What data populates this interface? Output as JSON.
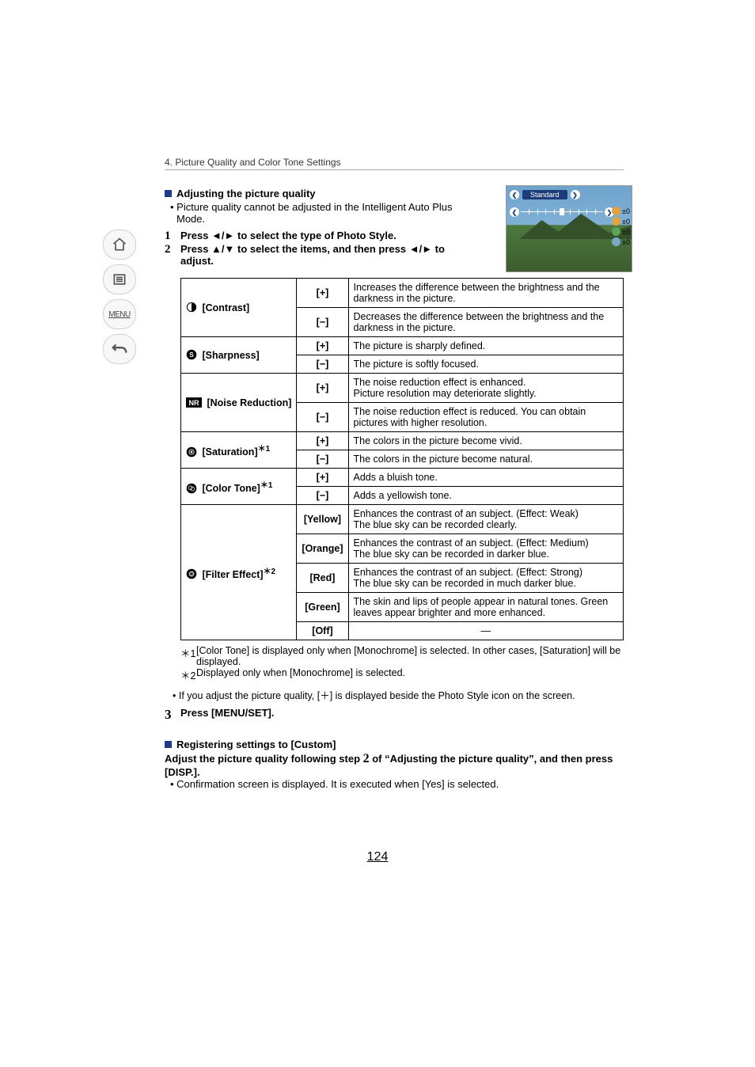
{
  "chapter": "4. Picture Quality and Color Tone Settings",
  "nav": {
    "menu_label": "MENU"
  },
  "section1": {
    "heading": "Adjusting the picture quality",
    "note": "Picture quality cannot be adjusted in the Intelligent Auto Plus Mode.",
    "step1_num": "1",
    "step1": "Press ◄/► to select the type of Photo Style.",
    "step2_num": "2",
    "step2": "Press ▲/▼ to select the items, and then press ◄/► to adjust."
  },
  "thumb": {
    "label": "Standard",
    "stats": [
      "±0",
      "±0",
      "±0",
      "±0"
    ]
  },
  "table": {
    "rows": [
      {
        "name": "[Contrast]",
        "icon": "contrast-icon",
        "items": [
          {
            "k": "[+]",
            "d": "Increases the difference between the brightness and the darkness in the picture."
          },
          {
            "k": "[−]",
            "d": "Decreases the difference between the brightness and the darkness in the picture."
          }
        ]
      },
      {
        "name": "[Sharpness]",
        "icon": "sharpness-icon",
        "items": [
          {
            "k": "[+]",
            "d": "The picture is sharply defined."
          },
          {
            "k": "[−]",
            "d": "The picture is softly focused."
          }
        ]
      },
      {
        "name": "[Noise Reduction]",
        "icon": "nr-icon",
        "items": [
          {
            "k": "[+]",
            "d": "The noise reduction effect is enhanced.\nPicture resolution may deteriorate slightly."
          },
          {
            "k": "[−]",
            "d": "The noise reduction effect is reduced. You can obtain pictures with higher resolution."
          }
        ]
      },
      {
        "name": "[Saturation]",
        "sup": "＊1",
        "icon": "saturation-icon",
        "items": [
          {
            "k": "[+]",
            "d": "The colors in the picture become vivid."
          },
          {
            "k": "[−]",
            "d": "The colors in the picture become natural."
          }
        ]
      },
      {
        "name": "[Color Tone]",
        "sup": "＊1",
        "icon": "colortone-icon",
        "items": [
          {
            "k": "[+]",
            "d": "Adds a bluish tone."
          },
          {
            "k": "[−]",
            "d": "Adds a yellowish tone."
          }
        ]
      },
      {
        "name": "[Filter Effect]",
        "sup": "＊2",
        "icon": "filter-icon",
        "items": [
          {
            "k": "[Yellow]",
            "d": "Enhances the contrast of an subject. (Effect: Weak)\nThe blue sky can be recorded clearly."
          },
          {
            "k": "[Orange]",
            "d": "Enhances the contrast of an subject. (Effect: Medium)\nThe blue sky can be recorded in darker blue."
          },
          {
            "k": "[Red]",
            "d": "Enhances the contrast of an subject. (Effect: Strong)\nThe blue sky can be recorded in much darker blue."
          },
          {
            "k": "[Green]",
            "d": "The skin and lips of people appear in natural tones. Green leaves appear brighter and more enhanced."
          },
          {
            "k": "[Off]",
            "d": "—",
            "dash": true
          }
        ]
      }
    ]
  },
  "footnotes": {
    "f1_mark": "＊1",
    "f1": "[Color Tone] is displayed only when [Monochrome] is selected. In other cases, [Saturation] will be displayed.",
    "f2_mark": "＊2",
    "f2": "Displayed only when [Monochrome] is selected."
  },
  "note_q": "If you adjust the picture quality, [＋] is displayed beside the Photo Style icon on the screen.",
  "step3_num": "3",
  "step3": "Press [MENU/SET].",
  "section2": {
    "heading": "Registering settings to [Custom]",
    "line_a": "Adjust the picture quality following step ",
    "line_b": "2",
    "line_c": " of “Adjusting the picture quality”, and then press ",
    "disp": "[DISP.]",
    "dot": ".",
    "conf": "Confirmation screen is displayed. It is executed when [Yes] is selected."
  },
  "page_number": "124"
}
